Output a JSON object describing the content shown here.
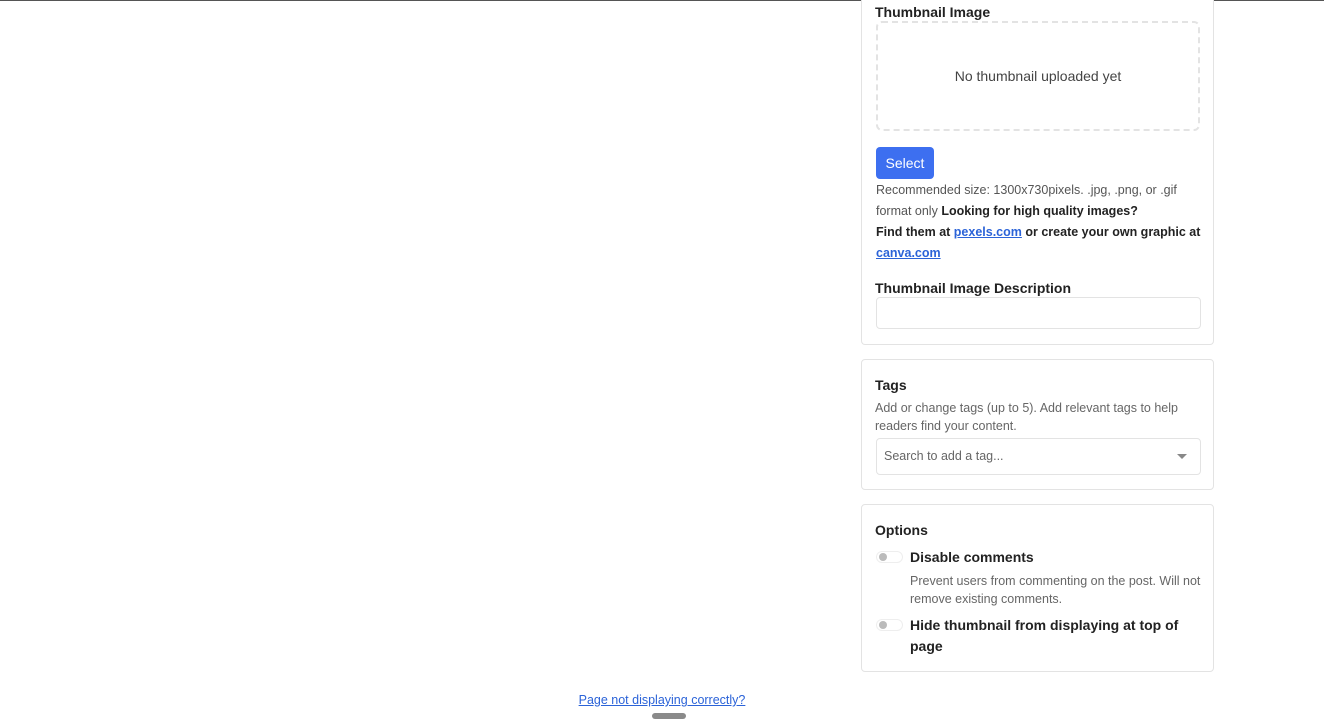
{
  "thumbnail": {
    "heading": "Thumbnail Image",
    "placeholder": "No thumbnail uploaded yet",
    "select_label": "Select",
    "help_line1": "Recommended size: 1300x730pixels. .jpg, .png, or .gif format only",
    "help_bold": "Looking for high quality images?",
    "find_prefix": "Find them at",
    "link_pexels": "pexels.com",
    "find_middle": "or create your own graphic at",
    "link_canva": "canva.com",
    "description_heading": "Thumbnail Image Description",
    "description_value": ""
  },
  "tags": {
    "heading": "Tags",
    "description": "Add or change tags (up to 5). Add relevant tags to help readers find your content.",
    "search_placeholder": "Search to add a tag..."
  },
  "options": {
    "heading": "Options",
    "items": [
      {
        "label": "Disable comments",
        "description": "Prevent users from commenting on the post. Will not remove existing comments.",
        "enabled": false
      },
      {
        "label": "Hide thumbnail from displaying at top of page",
        "description": "",
        "enabled": false
      }
    ]
  },
  "footer": {
    "link": "Page not displaying correctly?"
  },
  "colors": {
    "accent": "#3d6ff0",
    "link": "#2b63d8"
  }
}
